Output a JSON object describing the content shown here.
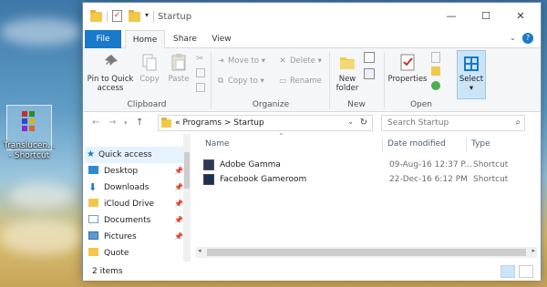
{
  "desktop": {
    "icon_label": "Translucen... - Shortcut"
  },
  "window": {
    "title": "Startup",
    "controls": {
      "minimize": "—",
      "maximize": "☐",
      "close": "✕"
    }
  },
  "tabs": [
    "File",
    "Home",
    "Share",
    "View"
  ],
  "ribbon": {
    "clipboard": {
      "pin": "Pin to Quick access",
      "copy": "Copy",
      "paste": "Paste",
      "group": "Clipboard"
    },
    "organize": {
      "move_to": "Move to",
      "copy_to": "Copy to",
      "delete": "Delete",
      "rename": "Rename",
      "group": "Organize"
    },
    "new": {
      "new_folder": "New folder",
      "group": "New"
    },
    "open": {
      "properties": "Properties",
      "group": "Open"
    },
    "select": {
      "label": "Select"
    }
  },
  "address": {
    "path": "« Programs > Startup",
    "search_placeholder": "Search Startup"
  },
  "nav": {
    "items": [
      {
        "label": "Quick access",
        "pinned": false,
        "icon": "star-icon"
      },
      {
        "label": "Desktop",
        "pinned": true,
        "icon": "desktop-icon"
      },
      {
        "label": "Downloads",
        "pinned": true,
        "icon": "download-icon"
      },
      {
        "label": "iCloud Drive",
        "pinned": true,
        "icon": "folder-icon"
      },
      {
        "label": "Documents",
        "pinned": true,
        "icon": "documents-icon"
      },
      {
        "label": "Pictures",
        "pinned": true,
        "icon": "pictures-icon"
      },
      {
        "label": "Quote",
        "pinned": false,
        "icon": "folder-icon"
      }
    ]
  },
  "files": {
    "columns": {
      "name": "Name",
      "date": "Date modified",
      "type": "Type"
    },
    "rows": [
      {
        "name": "Adobe Gamma",
        "date": "09-Aug-16 12:37 P...",
        "type": "Shortcut"
      },
      {
        "name": "Facebook Gameroom",
        "date": "22-Dec-16 6:12 PM",
        "type": "Shortcut"
      }
    ]
  },
  "status": {
    "count": "2 items"
  },
  "colors": {
    "accent": "#1979ca",
    "selection": "#cce4f7",
    "folder": "#f2c84b"
  }
}
